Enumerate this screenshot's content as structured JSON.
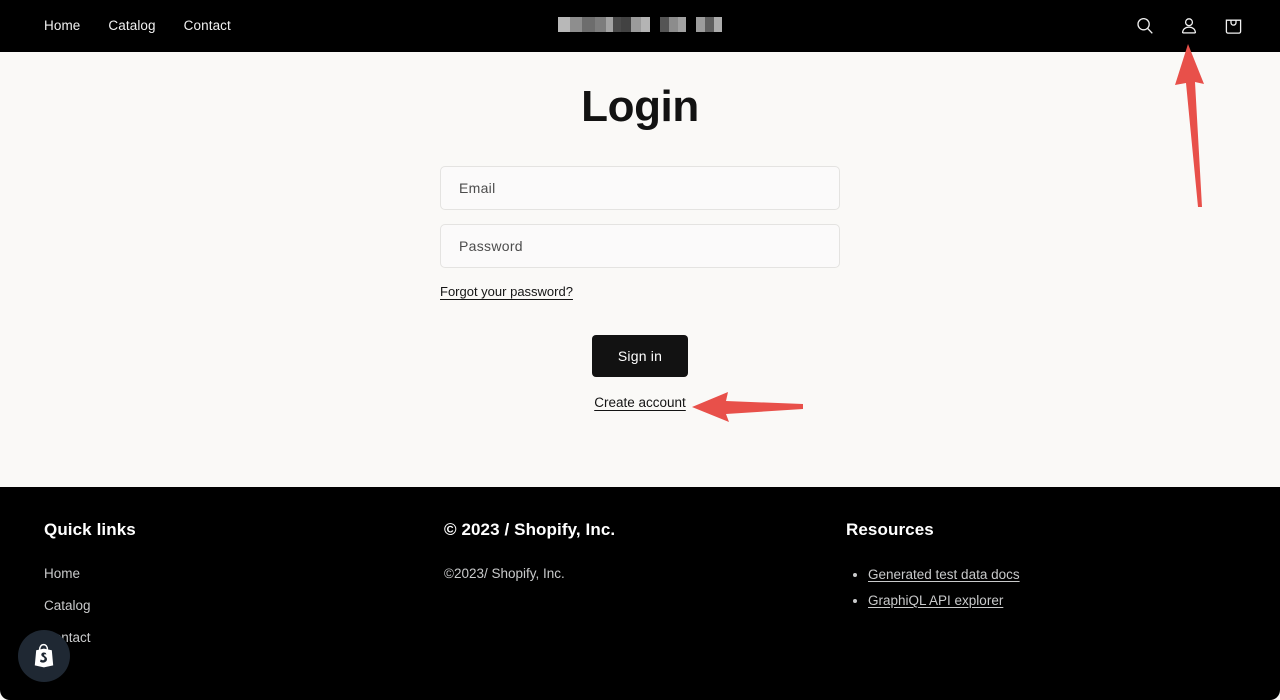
{
  "header": {
    "nav": [
      {
        "label": "Home"
      },
      {
        "label": "Catalog"
      },
      {
        "label": "Contact"
      }
    ],
    "store_name_redacted": true,
    "icons": [
      {
        "name": "search-icon",
        "label": "Search"
      },
      {
        "name": "account-icon",
        "label": "Account"
      },
      {
        "name": "cart-icon",
        "label": "Cart"
      }
    ]
  },
  "main": {
    "title": "Login",
    "email": {
      "placeholder": "Email",
      "value": ""
    },
    "password": {
      "placeholder": "Password",
      "value": ""
    },
    "forgot_password_label": "Forgot your password?",
    "sign_in_label": "Sign in",
    "create_account_label": "Create account"
  },
  "annotations": {
    "arrow_color": "#e8504a",
    "arrows": [
      {
        "name": "arrow-to-account-icon",
        "direction": "up",
        "target": "account-icon"
      },
      {
        "name": "arrow-to-create-account",
        "direction": "left",
        "target": "create-account-link"
      }
    ]
  },
  "footer": {
    "quick_links": {
      "heading": "Quick links",
      "items": [
        {
          "label": "Home"
        },
        {
          "label": "Catalog"
        },
        {
          "label": "Contact"
        }
      ]
    },
    "copyright": {
      "heading": "© 2023 / Shopify, Inc.",
      "text": "©2023/ Shopify, Inc."
    },
    "resources": {
      "heading": "Resources",
      "items": [
        {
          "label": "Generated test data docs"
        },
        {
          "label": "GraphiQL API explorer"
        }
      ]
    }
  },
  "badge": {
    "name": "shopify-bag-badge",
    "label": "Shopify"
  },
  "colors": {
    "header_bg": "#000000",
    "page_bg": "#faf9f7",
    "footer_bg": "#000000",
    "button_bg": "#121212",
    "accent_red": "#e8504a"
  }
}
